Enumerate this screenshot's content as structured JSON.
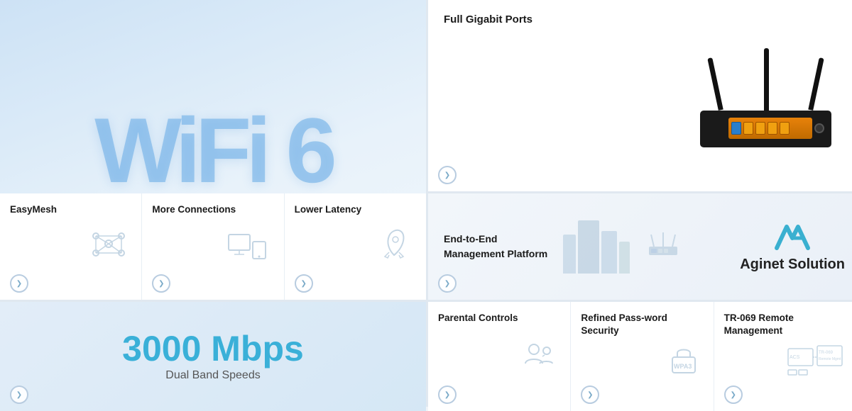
{
  "cards": {
    "wifi6": {
      "text": "WiFi 6"
    },
    "gigabit": {
      "title": "Full Gigabit Ports"
    },
    "management": {
      "title_line1": "End-to-End",
      "title_line2": "Management Platform",
      "brand": "Aginet Solution"
    },
    "speed": {
      "value": "3000 Mbps",
      "label": "Dual Band Speeds"
    },
    "features": [
      {
        "title": "EasyMesh",
        "icon": "mesh-icon"
      },
      {
        "title": "More Connections",
        "icon": "devices-icon"
      },
      {
        "title": "Lower Latency",
        "icon": "rocket-icon"
      }
    ],
    "bottom_features": [
      {
        "title": "Parental Controls",
        "icon": "parental-icon"
      },
      {
        "title": "Refined Pass-word Security",
        "icon": "wpa-icon"
      },
      {
        "title": "TR-069 Remote Management",
        "icon": "remote-icon"
      }
    ]
  },
  "chevron_label": "›",
  "icons": {
    "chevron_down": "❯"
  }
}
